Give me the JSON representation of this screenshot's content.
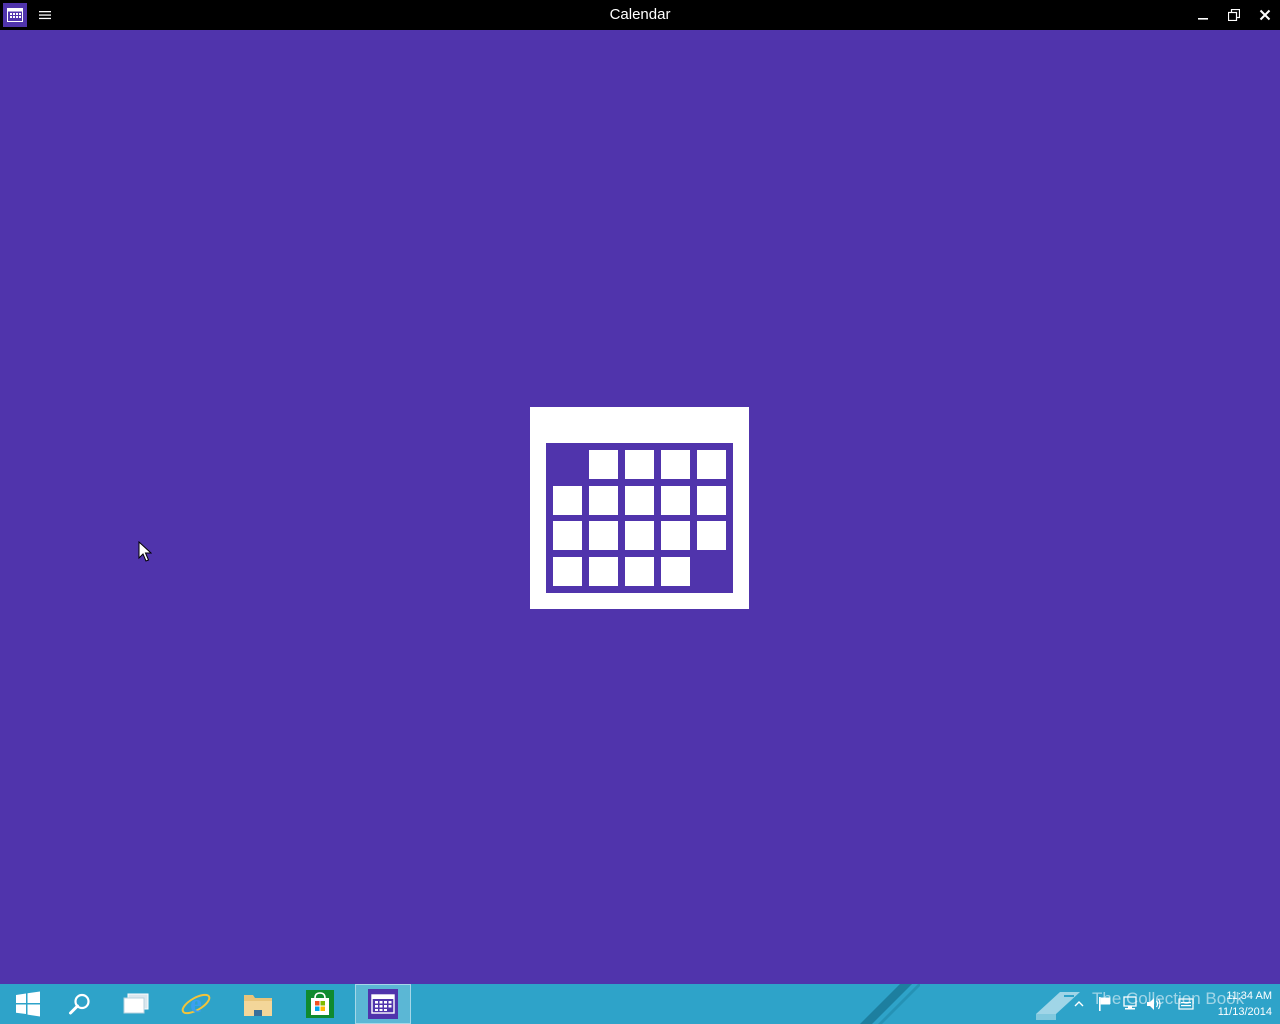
{
  "window": {
    "title": "Calendar",
    "app_icon": "calendar-icon",
    "menu_icon": "hamburger-icon",
    "controls": [
      "minimize-icon",
      "restore-icon",
      "close-icon"
    ]
  },
  "splash": {
    "background": "#5034ac",
    "logo": "calendar-grid-logo"
  },
  "taskbar": {
    "background": "#2ea3c9",
    "items": [
      {
        "name": "start",
        "icon": "windows-logo-icon"
      },
      {
        "name": "search",
        "icon": "search-icon"
      },
      {
        "name": "task-view",
        "icon": "task-view-icon"
      },
      {
        "name": "internet-explorer",
        "icon": "internet-explorer-icon"
      },
      {
        "name": "file-explorer",
        "icon": "folder-icon"
      },
      {
        "name": "store",
        "icon": "store-bag-icon"
      },
      {
        "name": "calendar",
        "icon": "calendar-icon",
        "active": true
      }
    ],
    "watermark": "The Collection Book",
    "clock": {
      "time": "11:34 AM",
      "date": "11/13/2014"
    },
    "tray_icons": [
      "show-hidden-icons-chevron",
      "action-center-flag-icon",
      "network-icon",
      "volume-icon",
      "input-method-icon"
    ]
  }
}
